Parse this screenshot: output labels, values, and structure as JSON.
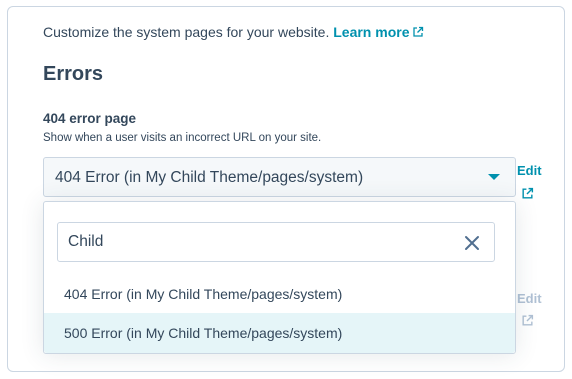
{
  "intro": {
    "text": "Customize the system pages for your website.",
    "learn_more": "Learn more",
    "learn_more_icon": "external-link-icon"
  },
  "section": {
    "heading": "Errors"
  },
  "error_404": {
    "label": "404 error page",
    "help": "Show when a user visits an incorrect URL on your site.",
    "selected_value": "404 Error (in My Child Theme/pages/system)",
    "edit_label": "Edit",
    "edit_icon": "external-link-icon"
  },
  "dropdown": {
    "search_value": "Child",
    "clear_icon": "close-icon",
    "options": [
      {
        "label": "404 Error (in My Child Theme/pages/system)"
      },
      {
        "label": "500 Error (in My Child Theme/pages/system)"
      }
    ]
  },
  "error_500": {
    "edit_label": "Edit",
    "edit_icon": "external-link-icon"
  },
  "colors": {
    "link": "#0091ae",
    "text": "#33475b",
    "border": "#cbd6e2",
    "highlight": "#e5f5f8",
    "disabled": "#b0c1d4"
  }
}
